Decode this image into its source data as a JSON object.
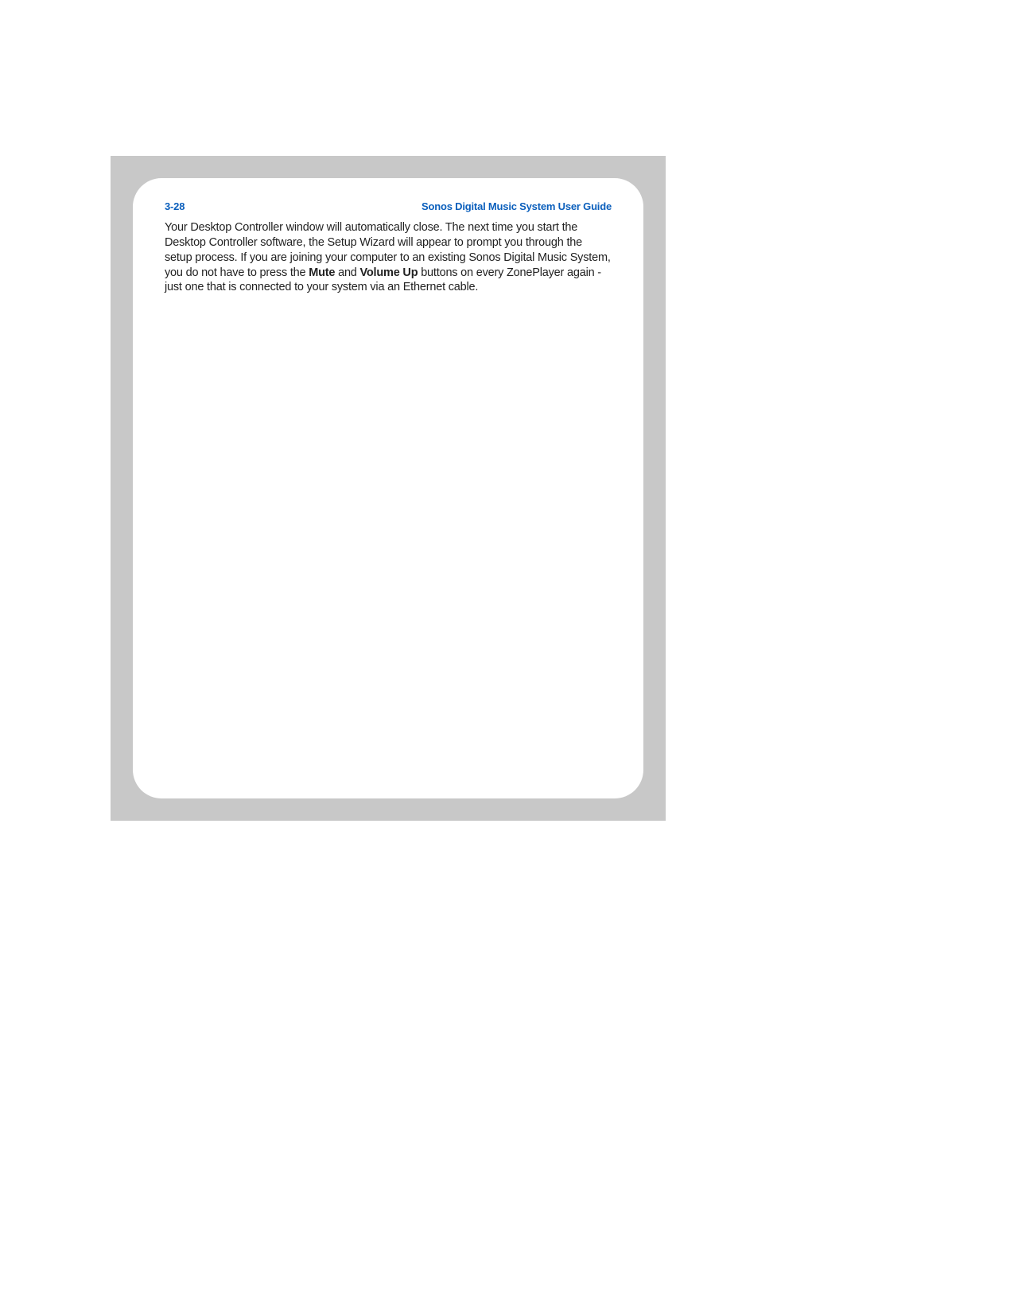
{
  "header": {
    "page_number": "3-28",
    "doc_title": "Sonos Digital Music System User Guide"
  },
  "body": {
    "part1": "Your Desktop Controller window will automatically close. The next time you start the Desktop Controller software, the Setup Wizard will appear to prompt you through the setup process. If you are joining your computer to an existing Sonos Digital Music System, you do not have to press the ",
    "bold1": "Mute",
    "part2": " and ",
    "bold2": "Volume Up",
    "part3": " buttons on every ZonePlayer again - just one that is connected to your system via an Ethernet cable."
  }
}
